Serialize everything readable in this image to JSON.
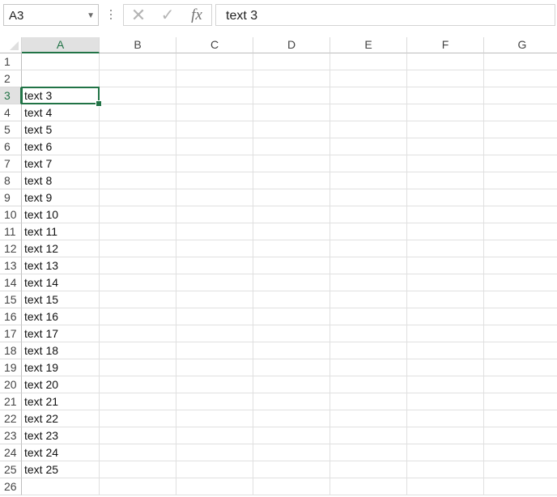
{
  "formula_bar": {
    "name_box": "A3",
    "name_box_arrow_icon": "chevron-down-icon",
    "cancel_icon": "✕",
    "enter_icon": "✓",
    "fx_label": "fx",
    "formula": "text 3"
  },
  "columns": [
    "A",
    "B",
    "C",
    "D",
    "E",
    "F",
    "G"
  ],
  "selected_column": "A",
  "rows": [
    {
      "num": "1",
      "a": ""
    },
    {
      "num": "2",
      "a": ""
    },
    {
      "num": "3",
      "a": "text 3"
    },
    {
      "num": "4",
      "a": "text 4"
    },
    {
      "num": "5",
      "a": "text 5"
    },
    {
      "num": "6",
      "a": "text 6"
    },
    {
      "num": "7",
      "a": "text 7"
    },
    {
      "num": "8",
      "a": "text 8"
    },
    {
      "num": "9",
      "a": "text 9"
    },
    {
      "num": "10",
      "a": "text 10"
    },
    {
      "num": "11",
      "a": "text 11"
    },
    {
      "num": "12",
      "a": "text 12"
    },
    {
      "num": "13",
      "a": "text 13"
    },
    {
      "num": "14",
      "a": "text 14"
    },
    {
      "num": "15",
      "a": "text 15"
    },
    {
      "num": "16",
      "a": "text 16"
    },
    {
      "num": "17",
      "a": "text 17"
    },
    {
      "num": "18",
      "a": "text 18"
    },
    {
      "num": "19",
      "a": "text 19"
    },
    {
      "num": "20",
      "a": "text 20"
    },
    {
      "num": "21",
      "a": "text 21"
    },
    {
      "num": "22",
      "a": "text 22"
    },
    {
      "num": "23",
      "a": "text 23"
    },
    {
      "num": "24",
      "a": "text 24"
    },
    {
      "num": "25",
      "a": "text 25"
    },
    {
      "num": "26",
      "a": ""
    }
  ],
  "selected_row": "3",
  "colors": {
    "selection": "#217346",
    "gridline": "#e0e0e0",
    "header_selected_bg": "#e1e1e1"
  }
}
